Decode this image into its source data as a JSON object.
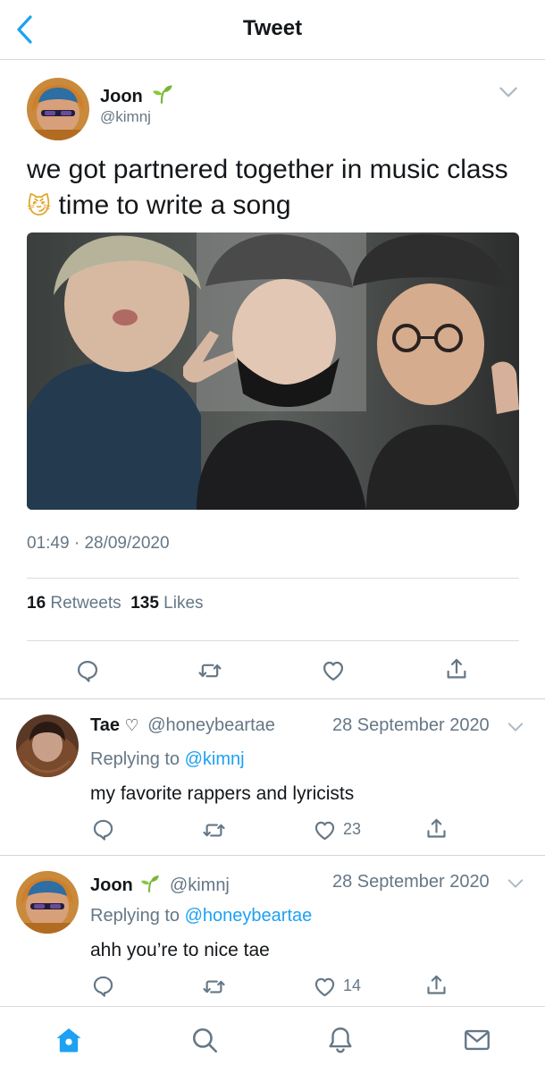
{
  "header": {
    "title": "Tweet"
  },
  "tweet": {
    "name": "Joon",
    "handle": "@kimnj",
    "text_before": "we got partnered together in music class",
    "emoji": "😼",
    "text_after": "time to write a song",
    "time": "01:49",
    "separator": "·",
    "date": "28/09/2020",
    "retweets_count": "16",
    "retweets_label": "Retweets",
    "likes_count": "135",
    "likes_label": "Likes"
  },
  "replies": [
    {
      "name": "Tae",
      "name_symbol": "♡",
      "handle": "@honeybeartae",
      "date": "28 September 2020",
      "replying_prefix": "Replying to",
      "replying_to": "@kimnj",
      "text": "my favorite rappers and lyricists",
      "likes": "23"
    },
    {
      "name": "Joon",
      "handle": "@kimnj",
      "date": "28 September 2020",
      "replying_prefix": "Replying to",
      "replying_to": "@honeybeartae",
      "text": "ahh you’re to nice tae",
      "likes": "14"
    }
  ],
  "colors": {
    "accent": "#1da1f2",
    "muted": "#657786",
    "divider": "#dcdcdc"
  },
  "icons": [
    "back-chevron-icon",
    "sprout-icon",
    "chevron-down-icon",
    "reply-icon",
    "retweet-icon",
    "like-icon",
    "share-icon",
    "home-icon",
    "search-icon",
    "notifications-icon",
    "messages-icon"
  ]
}
